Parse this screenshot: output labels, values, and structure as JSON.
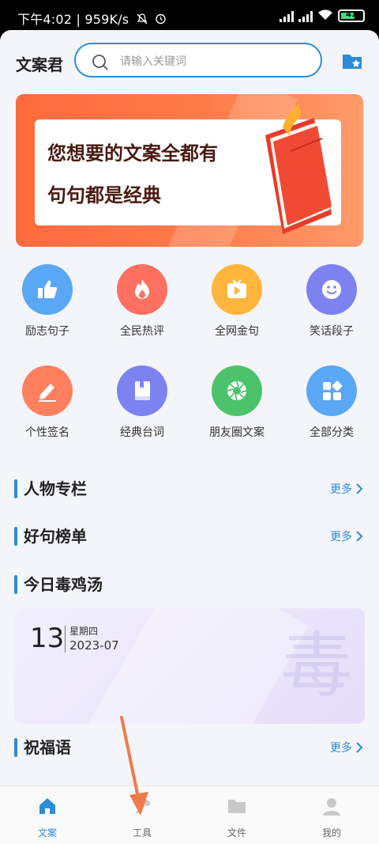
{
  "status_bar": {
    "time": "下午4:02",
    "speed": "959K/s",
    "battery": "41"
  },
  "header": {
    "app_title": "文案君",
    "search_placeholder": "请输入关键词"
  },
  "banner": {
    "line1": "您想要的文案全都有",
    "line2": "句句都是经典"
  },
  "categories": [
    {
      "label": "励志句子",
      "icon": "thumbs-up-icon",
      "color": "#5aa7f5"
    },
    {
      "label": "全民热评",
      "icon": "flame-icon",
      "color": "#ff7060"
    },
    {
      "label": "全网金句",
      "icon": "play-tv-icon",
      "color": "#ffb53b"
    },
    {
      "label": "笑话段子",
      "icon": "smile-icon",
      "color": "#7c82f0"
    },
    {
      "label": "个性签名",
      "icon": "pencil-icon",
      "color": "#ff7f5e"
    },
    {
      "label": "经典台词",
      "icon": "book-icon",
      "color": "#7c82f0"
    },
    {
      "label": "朋友圈文案",
      "icon": "aperture-icon",
      "color": "#4cc36a"
    },
    {
      "label": "全部分类",
      "icon": "grid-icon",
      "color": "#5aa7f5"
    }
  ],
  "sections": {
    "people": {
      "title": "人物专栏",
      "more": "更多"
    },
    "rank": {
      "title": "好句榜单",
      "more": "更多"
    },
    "soup": {
      "title": "今日毒鸡汤"
    },
    "blessing": {
      "title": "祝福语",
      "more": "更多"
    }
  },
  "daily_card": {
    "day": "13",
    "weekday": "星期四",
    "year_month": "2023-07",
    "watermark": "毒"
  },
  "tabbar": {
    "tabs": [
      {
        "label": "文案",
        "active": true
      },
      {
        "label": "工具",
        "active": false
      },
      {
        "label": "文件",
        "active": false
      },
      {
        "label": "我的",
        "active": false
      }
    ]
  },
  "colors": {
    "accent": "#2e8bd6",
    "banner": "#fe6a3d",
    "arrow": "#f07a4a"
  }
}
